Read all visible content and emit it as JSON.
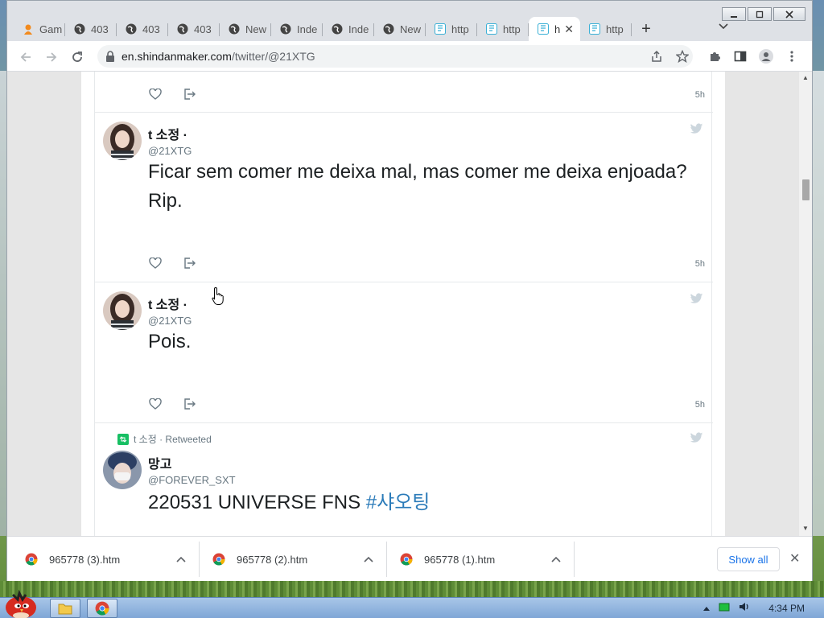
{
  "browser": {
    "tabs": [
      {
        "label": "Gam",
        "icon": "game-icon"
      },
      {
        "label": "403",
        "icon": "globe-icon"
      },
      {
        "label": "403",
        "icon": "globe-icon"
      },
      {
        "label": "403",
        "icon": "globe-icon"
      },
      {
        "label": "New",
        "icon": "globe-icon"
      },
      {
        "label": "Inde",
        "icon": "globe-icon"
      },
      {
        "label": "Inde",
        "icon": "globe-icon"
      },
      {
        "label": "New",
        "icon": "globe-icon"
      },
      {
        "label": "http",
        "icon": "shindan-icon"
      },
      {
        "label": "http",
        "icon": "shindan-icon"
      },
      {
        "label": "h",
        "icon": "shindan-icon",
        "active": true
      },
      {
        "label": "http",
        "icon": "shindan-icon"
      }
    ],
    "new_tab": "+",
    "tab_menu": "⌄",
    "close_tab": "✕",
    "address": {
      "domain": "en.shindanmaker.com",
      "path": "/twitter/@21XTG"
    }
  },
  "tweets": [
    {
      "time": "5h"
    },
    {
      "name": "t 소정 ·",
      "handle": "@21XTG",
      "text": "Ficar sem comer me deixa mal, mas comer me deixa enjoada? Rip.",
      "time": "5h"
    },
    {
      "name": "t 소정 ·",
      "handle": "@21XTG",
      "text": "Pois.",
      "time": "5h"
    },
    {
      "retweeted_by": "t 소정 · Retweeted",
      "name": "망고",
      "handle": "@FOREVER_SXT",
      "text": "220531 UNIVERSE FNS ",
      "hashtag": "#샤오팅"
    }
  ],
  "downloads": {
    "items": [
      "965778 (3).htm",
      "965778 (2).htm",
      "965778 (1).htm"
    ],
    "show_all": "Show all",
    "close": "✕"
  },
  "taskbar": {
    "clock": "4:34 PM"
  },
  "colors": {
    "accent": "#1a73e8",
    "hashtag": "#2b7bb9",
    "retweet": "#17bf63",
    "twitter_bird": "#1da1f2"
  }
}
